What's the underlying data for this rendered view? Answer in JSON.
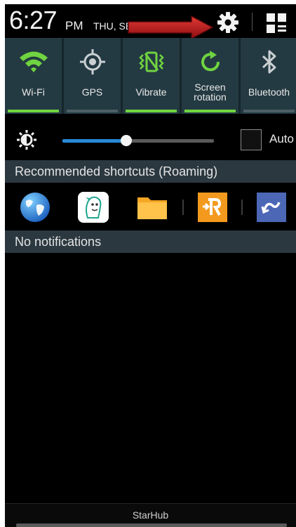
{
  "status_bar": {
    "time": "6:27",
    "ampm": "PM",
    "date": "THU, SE"
  },
  "quick_toggles": [
    {
      "label": "Wi-Fi",
      "icon": "wifi-icon",
      "on": true
    },
    {
      "label": "GPS",
      "icon": "gps-icon",
      "on": false
    },
    {
      "label": "Vibrate",
      "icon": "vibrate-icon",
      "on": true
    },
    {
      "label": "Screen rotation",
      "icon": "rotation-icon",
      "on": true
    },
    {
      "label": "Bluetooth",
      "icon": "bluetooth-icon",
      "on": false
    }
  ],
  "brightness": {
    "level": 0.42,
    "auto_label": "Auto",
    "auto_checked": false
  },
  "shortcuts_header": "Recommended shortcuts (Roaming)",
  "shortcuts": [
    {
      "icon": "globe-icon"
    },
    {
      "icon": "mascot-app-icon"
    },
    {
      "icon": "folder-icon"
    },
    {
      "icon": "roaming-app-icon"
    },
    {
      "icon": "swipe-app-icon"
    }
  ],
  "notifications_header": "No notifications",
  "carrier": "StarHub",
  "colors": {
    "toggle_on": "#6fd440",
    "slider_fill": "#2a8ad6",
    "arrow": "#c0141a"
  }
}
